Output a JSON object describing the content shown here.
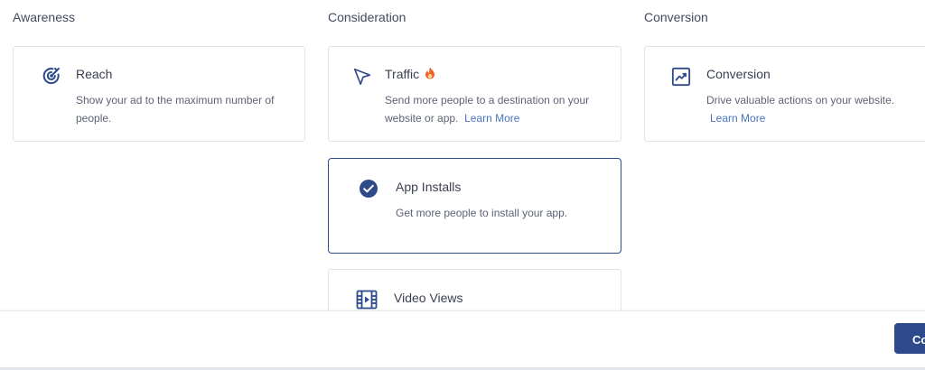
{
  "columns": {
    "awareness": {
      "title": "Awareness"
    },
    "consideration": {
      "title": "Consideration"
    },
    "conversion": {
      "title": "Conversion"
    }
  },
  "cards": {
    "reach": {
      "icon": "target-icon",
      "title": "Reach",
      "description": "Show your ad to the maximum number of people."
    },
    "traffic": {
      "icon": "cursor-arrow-icon",
      "badge_icon": "flame-icon",
      "title": "Traffic",
      "description": "Send more people to a destination on your website or app.",
      "link": "Learn More"
    },
    "conversion": {
      "icon": "trending-up-chart-icon",
      "title": "Conversion",
      "description": "Drive valuable actions on your website.",
      "link": "Learn More"
    },
    "app_installs": {
      "icon": "check-circle-icon",
      "title": "App Installs",
      "description": "Get more people to install your app.",
      "selected": true
    },
    "video_views": {
      "icon": "film-icon",
      "title": "Video Views"
    }
  },
  "footer": {
    "continue_label": "Continue"
  },
  "colors": {
    "accent": "#2e4a8a",
    "link": "#4a73c4",
    "flame": "#f26522"
  }
}
